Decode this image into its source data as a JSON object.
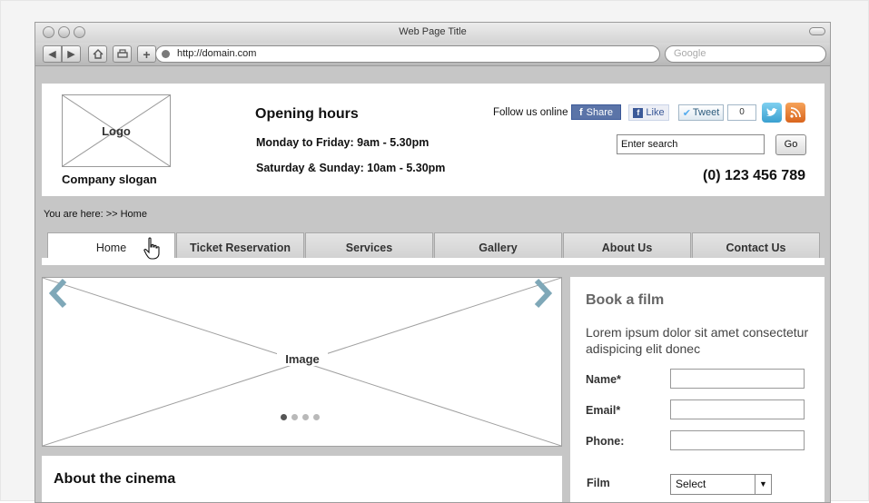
{
  "browser": {
    "window_title": "Web Page Title",
    "url": "http://domain.com",
    "search_placeholder": "Google"
  },
  "header": {
    "logo_label": "Logo",
    "slogan": "Company slogan",
    "hours_title": "Opening hours",
    "hours_weekday": "Monday to Friday: 9am - 5.30pm",
    "hours_weekend": "Saturday & Sunday: 10am - 5.30pm",
    "follow_label": "Follow us online",
    "share_label": "Share",
    "like_label": "Like",
    "tweet_label": "Tweet",
    "tweet_count": "0",
    "search_value": "Enter search",
    "go_label": "Go",
    "phone": "(0) 123 456 789"
  },
  "breadcrumb": "You are here: >> Home",
  "nav": {
    "tabs": [
      {
        "label": "Home",
        "active": true
      },
      {
        "label": "Ticket Reservation"
      },
      {
        "label": "Services"
      },
      {
        "label": "Gallery"
      },
      {
        "label": "About Us"
      },
      {
        "label": "Contact Us"
      }
    ]
  },
  "slider": {
    "image_label": "Image",
    "dot_count": 4,
    "active_dot": 1
  },
  "about": {
    "title": "About the cinema"
  },
  "book": {
    "title": "Book a film",
    "description": "Lorem ipsum dolor sit amet consectetur adispicing elit donec",
    "name_label": "Name*",
    "email_label": "Email*",
    "phone_label": "Phone:",
    "film_label": "Film",
    "film_select": "Select"
  },
  "colors": {
    "browser_bg": "#c6c6c6",
    "facebook": "#3b5998",
    "twitter": "#55acee",
    "rss": "#e8752a",
    "arrow": "#7fa8b8"
  }
}
